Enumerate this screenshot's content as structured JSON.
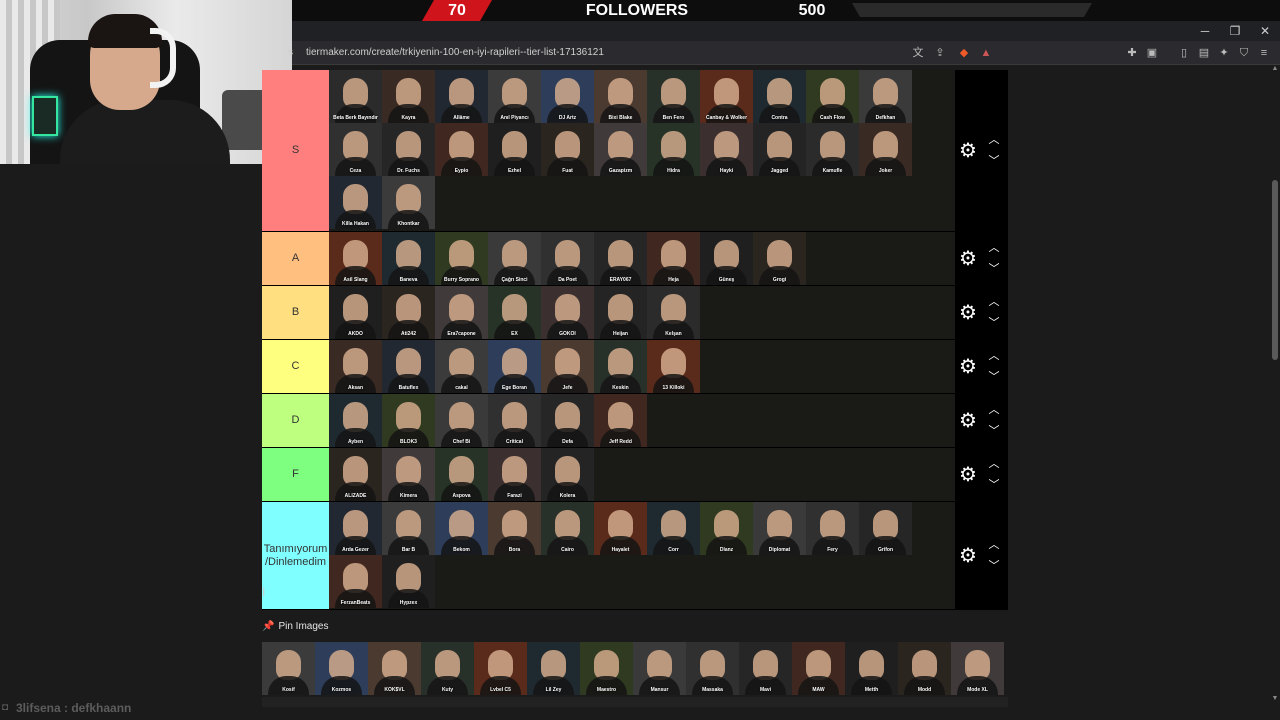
{
  "overlay": {
    "left_value": "70",
    "title": "FOLLOWERS",
    "right_value": "500"
  },
  "window_controls": {
    "minimize": "─",
    "restore": "❐",
    "close": "✕"
  },
  "address_bar": {
    "url": "tiermaker.com/create/trkiyenin-100-en-iyi-rapileri--tier-list-17136121",
    "left_glyph": "s"
  },
  "tiers": [
    {
      "label": "S",
      "color": "#ff7f7f",
      "items": [
        "Beta Berk Bayındır",
        "Kayra",
        "Allâme",
        "Anıl Piyancı",
        "DJ Artz",
        "Bixi Blake",
        "Ben Fero",
        "Canbay & Wolker",
        "Contra",
        "Cash Flow",
        "Defkhan",
        "Ceza",
        "Dr. Fuchs",
        "Eypio",
        "Ezhel",
        "Fuat",
        "Gazapizm",
        "Hidra",
        "Hayki",
        "Jagged",
        "Kamufle",
        "Joker",
        "Killa Hakan",
        "Khontkar"
      ]
    },
    {
      "label": "A",
      "color": "#ffbf7f",
      "items": [
        "Asil Slang",
        "Baneva",
        "Burry Soprano",
        "Çağrı Sinci",
        "Da Poet",
        "ERAY067",
        "Heja",
        "Güneş",
        "Grogi"
      ]
    },
    {
      "label": "B",
      "color": "#ffdf7f",
      "items": [
        "AKDO",
        "Ati242",
        "Era7capone",
        "EX",
        "GOKOI",
        "Heijan",
        "Kelşan"
      ]
    },
    {
      "label": "C",
      "color": "#ffff7f",
      "items": [
        "Aksan",
        "Batuflex",
        "cakal",
        "Ege Boran",
        "Jefe",
        "Keskin",
        "13 Killoki"
      ]
    },
    {
      "label": "D",
      "color": "#bfff7f",
      "items": [
        "Ayben",
        "BLOK3",
        "Chef Bi",
        "Critical",
        "Defa",
        "Jeff Redd"
      ]
    },
    {
      "label": "F",
      "color": "#7fff7f",
      "items": [
        "ALIZADE",
        "Kimera",
        "Aspova",
        "Farazi",
        "Kolera"
      ]
    },
    {
      "label": "Tanımıyorum\n/Dinlemedim",
      "color": "#7fffff",
      "items": [
        "Arda Gezer",
        "Bar B",
        "Bekom",
        "Bora",
        "Cairo",
        "Hayalet",
        "Corr",
        "Dlanz",
        "Diplomat",
        "Fery",
        "Grifon",
        "FerzanBeats",
        "Hypzex"
      ]
    }
  ],
  "pin": {
    "header": "Pin Images",
    "items": [
      "Kosif",
      "Kozmos",
      "KÖK$VL",
      "Kuty",
      "Lvbel C5",
      "Lil Zey",
      "Maestro",
      "Mansur",
      "Massaka",
      "Mavi",
      "MAW",
      "Metth",
      "Modd",
      "Mode XL"
    ]
  },
  "chat": {
    "message": "3lifsena : defkhaann"
  },
  "icons": {
    "gear": "gear-icon",
    "up": "chevron-up-icon",
    "down": "chevron-down-icon",
    "pin": "pin-icon"
  }
}
